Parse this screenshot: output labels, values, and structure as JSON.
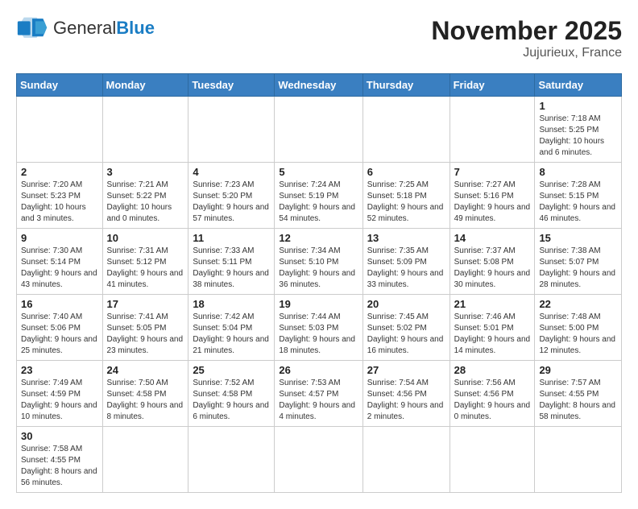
{
  "header": {
    "logo_general": "General",
    "logo_blue": "Blue",
    "month": "November 2025",
    "location": "Jujurieux, France"
  },
  "weekdays": [
    "Sunday",
    "Monday",
    "Tuesday",
    "Wednesday",
    "Thursday",
    "Friday",
    "Saturday"
  ],
  "weeks": [
    [
      {
        "day": "",
        "info": ""
      },
      {
        "day": "",
        "info": ""
      },
      {
        "day": "",
        "info": ""
      },
      {
        "day": "",
        "info": ""
      },
      {
        "day": "",
        "info": ""
      },
      {
        "day": "",
        "info": ""
      },
      {
        "day": "1",
        "info": "Sunrise: 7:18 AM\nSunset: 5:25 PM\nDaylight: 10 hours and 6 minutes."
      }
    ],
    [
      {
        "day": "2",
        "info": "Sunrise: 7:20 AM\nSunset: 5:23 PM\nDaylight: 10 hours and 3 minutes."
      },
      {
        "day": "3",
        "info": "Sunrise: 7:21 AM\nSunset: 5:22 PM\nDaylight: 10 hours and 0 minutes."
      },
      {
        "day": "4",
        "info": "Sunrise: 7:23 AM\nSunset: 5:20 PM\nDaylight: 9 hours and 57 minutes."
      },
      {
        "day": "5",
        "info": "Sunrise: 7:24 AM\nSunset: 5:19 PM\nDaylight: 9 hours and 54 minutes."
      },
      {
        "day": "6",
        "info": "Sunrise: 7:25 AM\nSunset: 5:18 PM\nDaylight: 9 hours and 52 minutes."
      },
      {
        "day": "7",
        "info": "Sunrise: 7:27 AM\nSunset: 5:16 PM\nDaylight: 9 hours and 49 minutes."
      },
      {
        "day": "8",
        "info": "Sunrise: 7:28 AM\nSunset: 5:15 PM\nDaylight: 9 hours and 46 minutes."
      }
    ],
    [
      {
        "day": "9",
        "info": "Sunrise: 7:30 AM\nSunset: 5:14 PM\nDaylight: 9 hours and 43 minutes."
      },
      {
        "day": "10",
        "info": "Sunrise: 7:31 AM\nSunset: 5:12 PM\nDaylight: 9 hours and 41 minutes."
      },
      {
        "day": "11",
        "info": "Sunrise: 7:33 AM\nSunset: 5:11 PM\nDaylight: 9 hours and 38 minutes."
      },
      {
        "day": "12",
        "info": "Sunrise: 7:34 AM\nSunset: 5:10 PM\nDaylight: 9 hours and 36 minutes."
      },
      {
        "day": "13",
        "info": "Sunrise: 7:35 AM\nSunset: 5:09 PM\nDaylight: 9 hours and 33 minutes."
      },
      {
        "day": "14",
        "info": "Sunrise: 7:37 AM\nSunset: 5:08 PM\nDaylight: 9 hours and 30 minutes."
      },
      {
        "day": "15",
        "info": "Sunrise: 7:38 AM\nSunset: 5:07 PM\nDaylight: 9 hours and 28 minutes."
      }
    ],
    [
      {
        "day": "16",
        "info": "Sunrise: 7:40 AM\nSunset: 5:06 PM\nDaylight: 9 hours and 25 minutes."
      },
      {
        "day": "17",
        "info": "Sunrise: 7:41 AM\nSunset: 5:05 PM\nDaylight: 9 hours and 23 minutes."
      },
      {
        "day": "18",
        "info": "Sunrise: 7:42 AM\nSunset: 5:04 PM\nDaylight: 9 hours and 21 minutes."
      },
      {
        "day": "19",
        "info": "Sunrise: 7:44 AM\nSunset: 5:03 PM\nDaylight: 9 hours and 18 minutes."
      },
      {
        "day": "20",
        "info": "Sunrise: 7:45 AM\nSunset: 5:02 PM\nDaylight: 9 hours and 16 minutes."
      },
      {
        "day": "21",
        "info": "Sunrise: 7:46 AM\nSunset: 5:01 PM\nDaylight: 9 hours and 14 minutes."
      },
      {
        "day": "22",
        "info": "Sunrise: 7:48 AM\nSunset: 5:00 PM\nDaylight: 9 hours and 12 minutes."
      }
    ],
    [
      {
        "day": "23",
        "info": "Sunrise: 7:49 AM\nSunset: 4:59 PM\nDaylight: 9 hours and 10 minutes."
      },
      {
        "day": "24",
        "info": "Sunrise: 7:50 AM\nSunset: 4:58 PM\nDaylight: 9 hours and 8 minutes."
      },
      {
        "day": "25",
        "info": "Sunrise: 7:52 AM\nSunset: 4:58 PM\nDaylight: 9 hours and 6 minutes."
      },
      {
        "day": "26",
        "info": "Sunrise: 7:53 AM\nSunset: 4:57 PM\nDaylight: 9 hours and 4 minutes."
      },
      {
        "day": "27",
        "info": "Sunrise: 7:54 AM\nSunset: 4:56 PM\nDaylight: 9 hours and 2 minutes."
      },
      {
        "day": "28",
        "info": "Sunrise: 7:56 AM\nSunset: 4:56 PM\nDaylight: 9 hours and 0 minutes."
      },
      {
        "day": "29",
        "info": "Sunrise: 7:57 AM\nSunset: 4:55 PM\nDaylight: 8 hours and 58 minutes."
      }
    ],
    [
      {
        "day": "30",
        "info": "Sunrise: 7:58 AM\nSunset: 4:55 PM\nDaylight: 8 hours and 56 minutes."
      },
      {
        "day": "",
        "info": ""
      },
      {
        "day": "",
        "info": ""
      },
      {
        "day": "",
        "info": ""
      },
      {
        "day": "",
        "info": ""
      },
      {
        "day": "",
        "info": ""
      },
      {
        "day": "",
        "info": ""
      }
    ]
  ]
}
